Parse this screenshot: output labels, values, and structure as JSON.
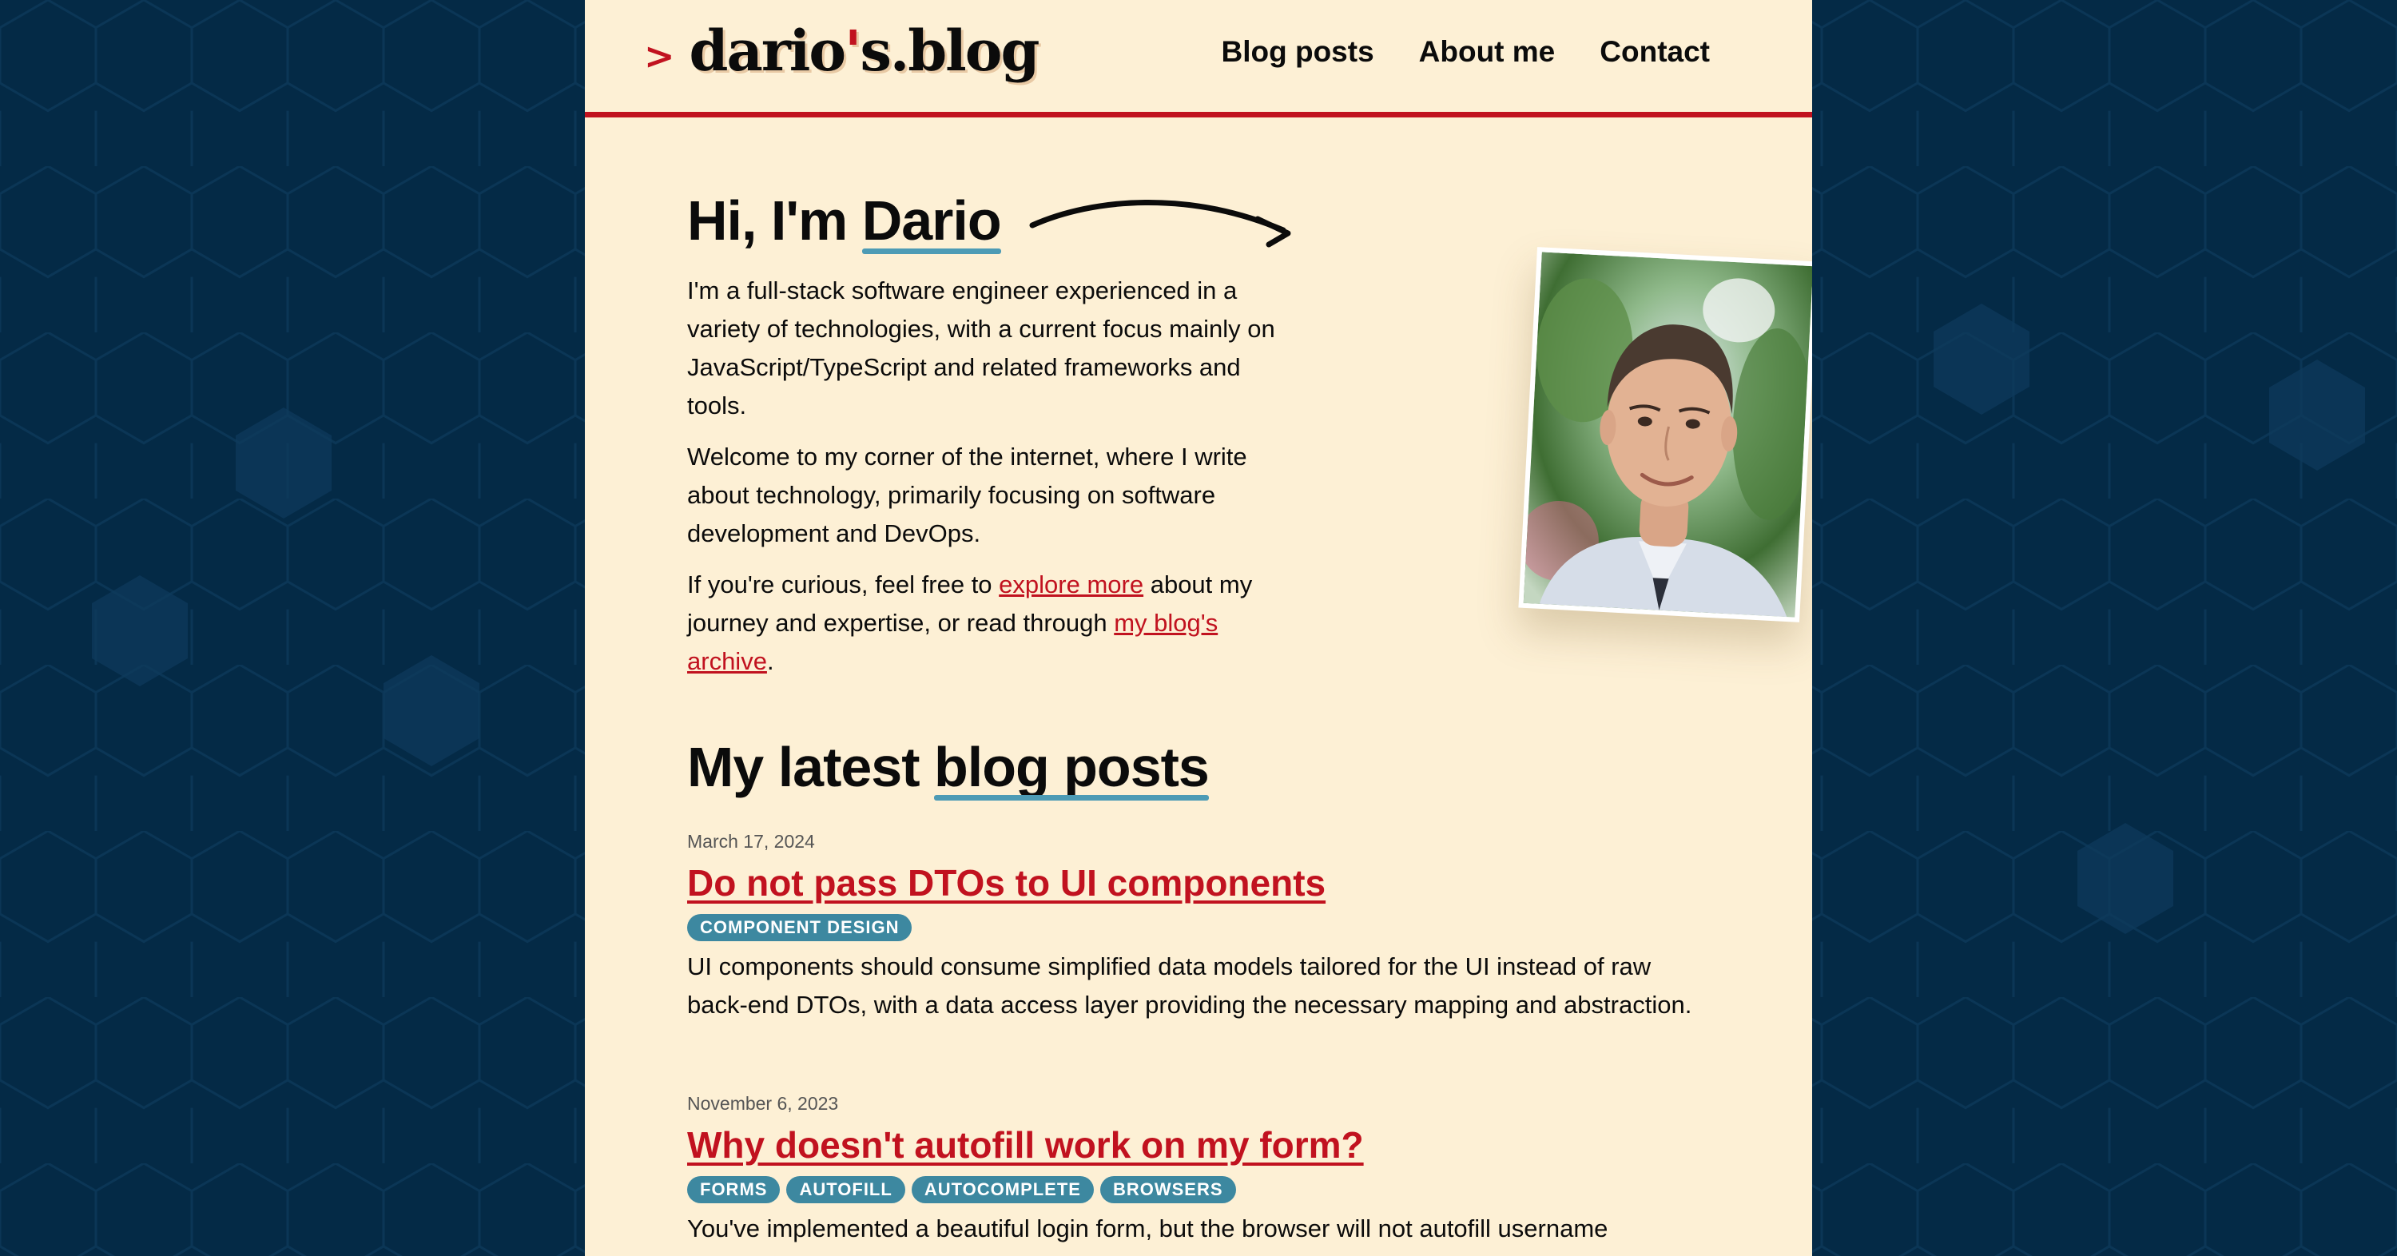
{
  "site": {
    "logo_prefix": ">",
    "logo_part1": "dario",
    "logo_apostrophe": "'",
    "logo_part2": "s.blog"
  },
  "nav": {
    "items": [
      {
        "label": "Blog posts"
      },
      {
        "label": "About me"
      },
      {
        "label": "Contact"
      }
    ]
  },
  "hero": {
    "title_prefix": "Hi, I'm ",
    "title_name": "Dario",
    "p1": "I'm a full-stack software engineer experienced in a variety of technologies, with a current focus mainly on JavaScript/TypeScript and related frameworks and tools.",
    "p2": "Welcome to my corner of the internet, where I write about technology, primarily focusing on software development and DevOps.",
    "p3_before": "If you're curious, feel free to ",
    "p3_link1": "explore more",
    "p3_middle": " about my journey and expertise, or read through ",
    "p3_link2": "my blog's archive",
    "p3_after": "."
  },
  "latest": {
    "title_prefix": "My latest ",
    "title_highlight": "blog posts"
  },
  "posts": [
    {
      "date": "March 17, 2024",
      "title": "Do not pass DTOs to UI components",
      "tags": [
        "COMPONENT DESIGN"
      ],
      "description": "UI components should consume simplified data models tailored for the UI instead of raw back-end DTOs, with a data access layer providing the necessary mapping and abstraction."
    },
    {
      "date": "November 6, 2023",
      "title": "Why doesn't autofill work on my form?",
      "tags": [
        "FORMS",
        "AUTOFILL",
        "AUTOCOMPLETE",
        "BROWSERS"
      ],
      "description": "You've implemented a beautiful login form, but the browser will not autofill username"
    }
  ],
  "colors": {
    "background": "#042a46",
    "page": "#fdf0d5",
    "accent": "#c1121f",
    "highlight": "#4d9bb5",
    "tag": "#3d88a0"
  }
}
